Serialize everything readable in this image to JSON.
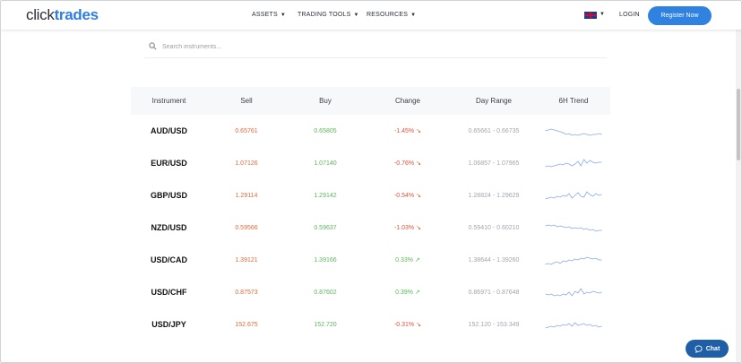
{
  "header": {
    "logo_prefix": "click",
    "logo_accent": "trades",
    "nav": [
      {
        "label": "ASSETS"
      },
      {
        "label": "TRADING TOOLS"
      },
      {
        "label": "RESOURCES"
      }
    ],
    "login_label": "LOGIN",
    "register_label": "Register Now"
  },
  "search": {
    "placeholder": "Search instruments..."
  },
  "table": {
    "columns": [
      "Instrument",
      "Sell",
      "Buy",
      "Change",
      "Day Range",
      "6H Trend"
    ],
    "rows": [
      {
        "instrument": "AUD/USD",
        "sell": "0.65761",
        "buy": "0.65805",
        "change": "-1.45%",
        "direction": "down",
        "range": "0.65661 - 0.66735",
        "trend": [
          8,
          7,
          6,
          7,
          8,
          9,
          10,
          12,
          11,
          13,
          12,
          13,
          12,
          11,
          12,
          13,
          12,
          12,
          11,
          12
        ]
      },
      {
        "instrument": "EUR/USD",
        "sell": "1.07126",
        "buy": "1.07140",
        "change": "-0.76%",
        "direction": "down",
        "range": "1.06857 - 1.07965",
        "trend": [
          12,
          11,
          12,
          11,
          10,
          9,
          10,
          8,
          9,
          11,
          9,
          6,
          11,
          4,
          8,
          5,
          7,
          8,
          7,
          7
        ]
      },
      {
        "instrument": "GBP/USD",
        "sell": "1.29114",
        "buy": "1.29142",
        "change": "-0.54%",
        "direction": "down",
        "range": "1.28824 - 1.29629",
        "trend": [
          12,
          11,
          10,
          11,
          9,
          10,
          8,
          9,
          6,
          11,
          8,
          5,
          9,
          10,
          4,
          7,
          9,
          6,
          8,
          7
        ]
      },
      {
        "instrument": "NZD/USD",
        "sell": "0.59566",
        "buy": "0.59637",
        "change": "-1.03%",
        "direction": "down",
        "range": "0.59410 - 0.60210",
        "trend": [
          6,
          5,
          6,
          5,
          7,
          6,
          7,
          8,
          7,
          9,
          8,
          9,
          8,
          10,
          9,
          11,
          10,
          12,
          11,
          11
        ]
      },
      {
        "instrument": "USD/CAD",
        "sell": "1.39121",
        "buy": "1.39166",
        "change": "0.33%",
        "direction": "up",
        "range": "1.38644 - 1.39260",
        "trend": [
          13,
          12,
          13,
          11,
          10,
          12,
          9,
          10,
          8,
          9,
          7,
          8,
          6,
          7,
          5,
          6,
          7,
          6,
          8,
          8
        ]
      },
      {
        "instrument": "USD/CHF",
        "sell": "0.87573",
        "buy": "0.87602",
        "change": "0.39%",
        "direction": "up",
        "range": "0.86971 - 0.87648",
        "trend": [
          10,
          11,
          10,
          12,
          11,
          12,
          10,
          11,
          8,
          12,
          7,
          9,
          4,
          10,
          8,
          9,
          7,
          8,
          9,
          8
        ]
      },
      {
        "instrument": "USD/JPY",
        "sell": "152.675",
        "buy": "152.720",
        "change": "-0.31%",
        "direction": "down",
        "range": "152.120 - 153.349",
        "trend": [
          12,
          11,
          10,
          11,
          9,
          10,
          8,
          9,
          7,
          10,
          6,
          9,
          8,
          7,
          9,
          8,
          10,
          9,
          11,
          10
        ]
      }
    ]
  },
  "chat_label": "Chat",
  "colors": {
    "accent": "#2f82e0",
    "sell": "#e06a3b",
    "buy": "#5cb85c",
    "down": "#e0533b",
    "up": "#5cb85c",
    "trend_line": "#8aa9e8"
  }
}
